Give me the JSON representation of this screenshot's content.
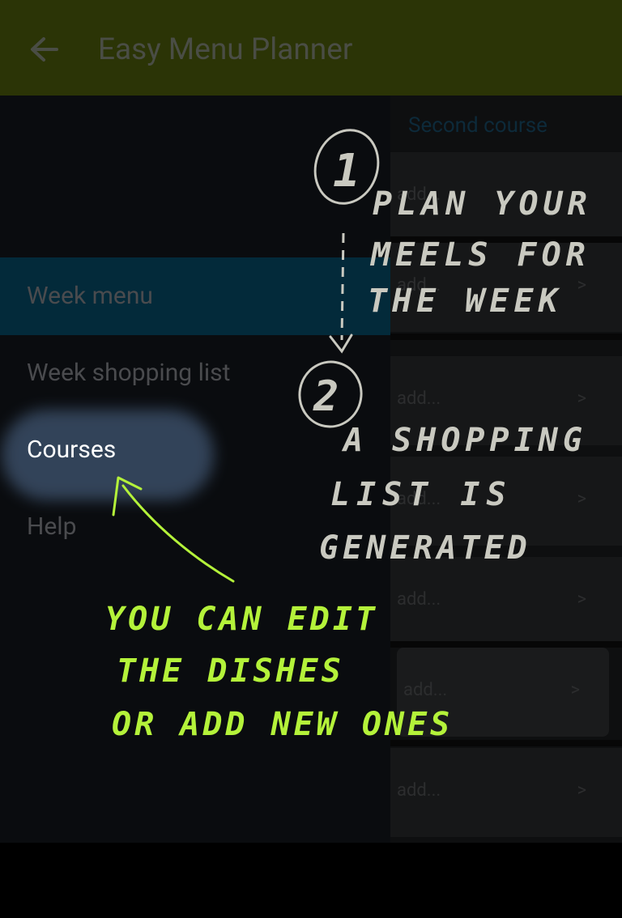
{
  "appbar": {
    "title": "Easy Menu Planner",
    "back_icon": "arrow-left-icon",
    "bg": "#2b3406"
  },
  "content": {
    "course_header": "Second course",
    "cards": [
      {
        "add_label": "add...",
        "chevron": ">"
      },
      {
        "add_label": "add...",
        "chevron": ">"
      },
      {
        "add_label": "add...",
        "chevron": ">"
      },
      {
        "add_label": "add...",
        "chevron": ">"
      },
      {
        "add_label": "add...",
        "chevron": ">"
      },
      {
        "add_label": "add...",
        "chevron": ">"
      },
      {
        "add_label": "add...",
        "chevron": ">"
      }
    ]
  },
  "drawer": {
    "items": [
      {
        "label": "Week menu",
        "active": true
      },
      {
        "label": "Week shopping list",
        "active": false
      },
      {
        "label": "Courses",
        "active": false,
        "highlighted": true
      },
      {
        "label": "Help",
        "active": false
      }
    ]
  },
  "annotations": {
    "step1_number": "1",
    "step1_lines": [
      "PLAN YOUR",
      "MEELS FOR",
      "THE WEEK"
    ],
    "step2_number": "2",
    "step2_lines": [
      "A SHOPPING",
      "LIST IS",
      "GENERATED"
    ],
    "courses_note_lines": [
      "YOU CAN EDIT",
      "THE DISHES",
      "OR ADD NEW ONES"
    ],
    "white_ink": "#c9c9c0",
    "green_ink": "#b4f23a"
  }
}
